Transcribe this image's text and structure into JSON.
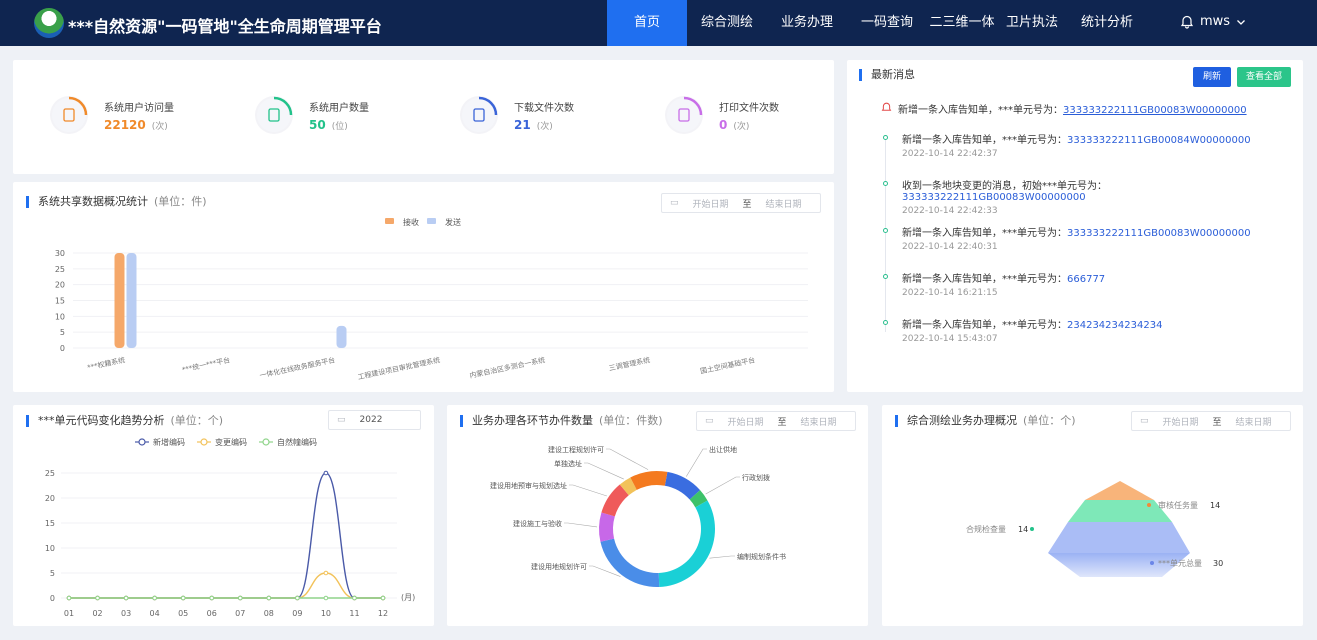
{
  "header": {
    "title": "***自然资源\"一码管地\"全生命周期管理平台",
    "nav": [
      "首页",
      "综合测绘",
      "业务办理",
      "一码查询",
      "二三维一体化",
      "卫片执法",
      "统计分析"
    ],
    "active_index": 0,
    "user": "mws"
  },
  "stats": [
    {
      "label": "系统用户访问量",
      "value": "22120",
      "unit": "(次)",
      "color": "#f08a2a"
    },
    {
      "label": "系统用户数量",
      "value": "50",
      "unit": "(位)",
      "color": "#22c28a"
    },
    {
      "label": "下载文件次数",
      "value": "21",
      "unit": "(次)",
      "color": "#3a64d8"
    },
    {
      "label": "打印文件次数",
      "value": "0",
      "unit": "(次)",
      "color": "#c86ee8"
    }
  ],
  "share_chart": {
    "title": "系统共享数据概况统计",
    "unit": "(单位：件)",
    "date_start": "开始日期",
    "date_sep": "至",
    "date_end": "结束日期"
  },
  "messages": {
    "title": "最新消息",
    "refresh": "刷新",
    "view_all": "查看全部",
    "items": [
      {
        "text": "新增一条入库告知单，***单元号为：",
        "code": "333333222111GB00083W00000000",
        "time": ""
      },
      {
        "text": "新增一条入库告知单，***单元号为：",
        "code": "333333222111GB00084W00000000",
        "time": "2022-10-14 22:42:37"
      },
      {
        "text": "收到一条地块变更的消息，初始***单元号为：",
        "code": "333333222111GB00083W00000000",
        "time": "2022-10-14 22:42:33"
      },
      {
        "text": "新增一条入库告知单，***单元号为：",
        "code": "333333222111GB00083W00000000",
        "time": "2022-10-14 22:40:31"
      },
      {
        "text": "新增一条入库告知单，***单元号为：",
        "code": "666777",
        "time": "2022-10-14 16:21:15"
      },
      {
        "text": "新增一条入库告知单，***单元号为：",
        "code": "234234234234234",
        "time": "2022-10-14 15:43:07"
      }
    ]
  },
  "trend": {
    "title": "***单元代码变化趋势分析",
    "unit": "(单位：个)",
    "year": "2022"
  },
  "business": {
    "title": "业务办理各环节办件数量",
    "unit": "(单位：件数)",
    "date_start": "开始日期",
    "date_sep": "至",
    "date_end": "结束日期"
  },
  "survey": {
    "title": "综合测绘业务办理概况",
    "unit": "(单位：个)",
    "date_start": "开始日期",
    "date_sep": "至",
    "date_end": "结束日期"
  },
  "chart_data": [
    {
      "type": "bar",
      "categories": [
        "***权籍系统",
        "***统一***平台",
        "一体化在线政务服务平台",
        "工程建设项目审批管理系统",
        "内蒙自治区多测合一系统",
        "三调管理系统",
        "国土空间基础平台"
      ],
      "series": [
        {
          "name": "接收",
          "values": [
            30,
            0,
            0,
            0,
            0,
            0,
            0
          ],
          "color": "#f5a86a"
        },
        {
          "name": "发送",
          "values": [
            30,
            0,
            7,
            0,
            0,
            0,
            0
          ],
          "color": "#b9cdf3"
        }
      ],
      "ylim": [
        0,
        30
      ],
      "yticks": [
        0,
        5,
        10,
        15,
        20,
        25,
        30
      ],
      "legend": "top-center"
    },
    {
      "type": "line",
      "x": [
        "01",
        "02",
        "03",
        "04",
        "05",
        "06",
        "07",
        "08",
        "09",
        "10",
        "11",
        "12"
      ],
      "xunit": "(月)",
      "series": [
        {
          "name": "新增编码",
          "values": [
            0,
            0,
            0,
            0,
            0,
            0,
            0,
            0,
            0,
            25,
            0,
            0
          ],
          "color": "#4a5aa8"
        },
        {
          "name": "变更编码",
          "values": [
            0,
            0,
            0,
            0,
            0,
            0,
            0,
            0,
            0,
            5,
            0,
            0
          ],
          "color": "#f2c25a"
        },
        {
          "name": "自然幢编码",
          "values": [
            0,
            0,
            0,
            0,
            0,
            0,
            0,
            0,
            0,
            0,
            0,
            0
          ],
          "color": "#8fd48a"
        }
      ],
      "ylim": [
        0,
        25
      ],
      "yticks": [
        0,
        5,
        10,
        15,
        20,
        25
      ],
      "legend": "top-center"
    },
    {
      "type": "pie",
      "donut": true,
      "labels": [
        "出让供地",
        "行政划拨",
        "编制规划条件书",
        "建设用地规划许可",
        "建设施工与验收",
        "建设用地预审与规划选址",
        "单独选址",
        "建设工程规划许可"
      ],
      "values": [
        9,
        3,
        28,
        19,
        7,
        8,
        3,
        9
      ],
      "colors": [
        "#3a6de0",
        "#3dc26a",
        "#1ad0d6",
        "#4a8de8",
        "#c768e8",
        "#ef5a5a",
        "#f2c25a",
        "#f47a1f"
      ]
    },
    {
      "type": "pyramid",
      "labels": [
        "审核任务量",
        "合规检查量",
        "***单元总量"
      ],
      "values": [
        14,
        14,
        30
      ],
      "colors": [
        "#f8b47a",
        "#7ee8b8",
        "#9bb2f4"
      ]
    }
  ]
}
